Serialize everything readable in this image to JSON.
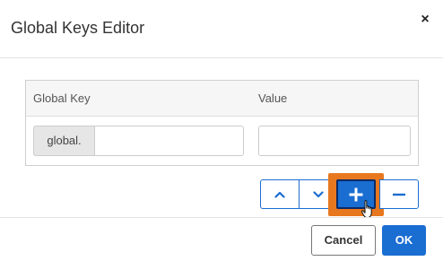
{
  "dialog": {
    "title": "Global Keys Editor",
    "close_glyph": "×",
    "close_icon": "close-icon"
  },
  "table": {
    "columns": [
      "Global Key",
      "Value"
    ],
    "rows": [
      {
        "prefix": "global.",
        "key": "",
        "value": ""
      }
    ]
  },
  "row_controls": {
    "move_up_icon": "chevron-up-icon",
    "move_down_icon": "chevron-down-icon",
    "add_icon": "plus-icon",
    "remove_icon": "minus-icon"
  },
  "footer": {
    "cancel_label": "Cancel",
    "ok_label": "OK"
  },
  "colors": {
    "accent": "#1a6dd1",
    "highlight": "#e8781f",
    "add_border": "#0b2a66"
  }
}
